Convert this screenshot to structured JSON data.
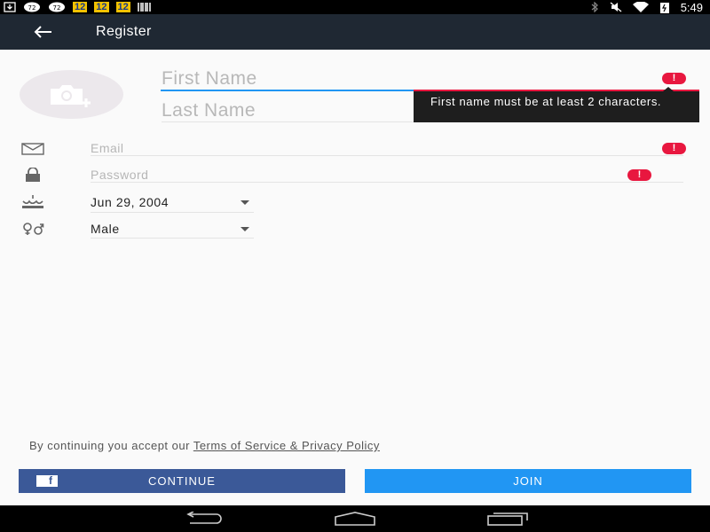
{
  "status_bar": {
    "badges": [
      "12",
      "12",
      "12"
    ],
    "time": "5:49"
  },
  "toolbar": {
    "title": "Register"
  },
  "form": {
    "first_name": {
      "value": "",
      "placeholder": "First Name"
    },
    "last_name": {
      "value": "",
      "placeholder": "Last Name"
    },
    "email": {
      "value": "",
      "placeholder": "Email"
    },
    "password": {
      "value": "",
      "placeholder": "Password"
    },
    "birthdate": "Jun 29, 2004",
    "gender": "Male",
    "error_icon": "!"
  },
  "tooltip": {
    "message": "First name must be at least 2 characters."
  },
  "terms": {
    "prefix": "By continuing you accept our ",
    "link": "Terms of Service & Privacy Policy"
  },
  "buttons": {
    "facebook_glyph": "f",
    "continue_label": "CONTINUE",
    "join_label": "JOIN"
  },
  "colors": {
    "toolbar": "#1f2833",
    "error": "#e8173f",
    "accent": "#2196f3",
    "facebook": "#3b5998"
  },
  "icons": [
    "back-arrow-icon",
    "camera-add-icon",
    "email-icon",
    "lock-icon",
    "cake-icon",
    "gender-icon",
    "error-icon",
    "facebook-icon",
    "nav-back-icon",
    "nav-home-icon",
    "nav-recents-icon"
  ]
}
